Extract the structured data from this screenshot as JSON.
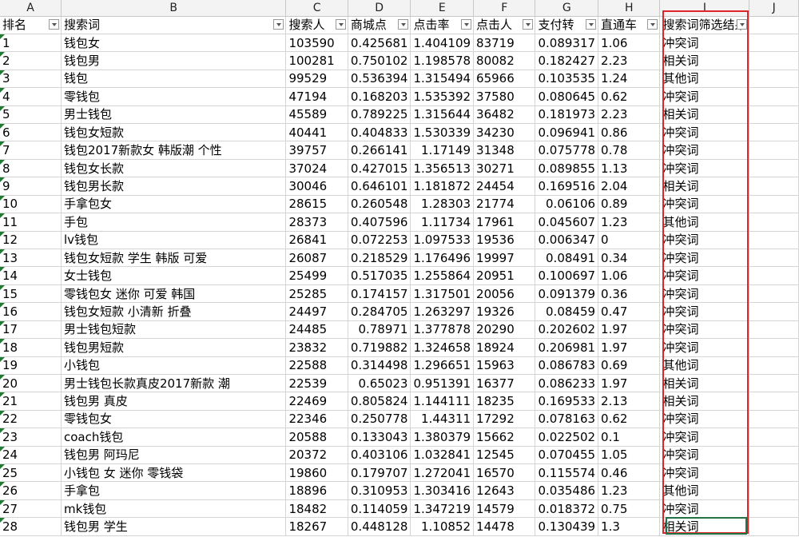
{
  "columns": [
    "A",
    "B",
    "C",
    "D",
    "E",
    "F",
    "G",
    "H",
    "I",
    "J"
  ],
  "headers": [
    "排名",
    "搜索词",
    "搜索人",
    "商城点",
    "点击率",
    "点击人",
    "支付转",
    "直通车",
    "搜索词筛选结果",
    ""
  ],
  "rows": [
    [
      "1",
      "钱包女",
      "103590",
      "0.425681",
      "1.404109",
      "83719",
      "0.089317",
      "1.06",
      "冲突词"
    ],
    [
      "2",
      "钱包男",
      "100281",
      "0.750102",
      "1.198578",
      "80082",
      "0.182427",
      "2.23",
      "相关词"
    ],
    [
      "3",
      "钱包",
      "99529",
      "0.536394",
      "1.315494",
      "65966",
      "0.103535",
      "1.24",
      "其他词"
    ],
    [
      "4",
      "零钱包",
      "47194",
      "0.168203",
      "1.535392",
      "37580",
      "0.080645",
      "0.62",
      "冲突词"
    ],
    [
      "5",
      "男士钱包",
      "45589",
      "0.789225",
      "1.315644",
      "36482",
      "0.181973",
      "2.23",
      "相关词"
    ],
    [
      "6",
      "钱包女短款",
      "40441",
      "0.404833",
      "1.530339",
      "34230",
      "0.096941",
      "0.86",
      "冲突词"
    ],
    [
      "7",
      "钱包2017新款女 韩版潮 个性",
      "39757",
      "0.266141",
      "1.17149",
      "31348",
      "0.075778",
      "0.78",
      "冲突词"
    ],
    [
      "8",
      "钱包女长款",
      "37024",
      "0.427015",
      "1.356513",
      "30271",
      "0.089855",
      "1.13",
      "冲突词"
    ],
    [
      "9",
      "钱包男长款",
      "30046",
      "0.646101",
      "1.181872",
      "24454",
      "0.169516",
      "2.04",
      "相关词"
    ],
    [
      "10",
      "手拿包女",
      "28615",
      "0.260548",
      "1.28303",
      "21774",
      "0.06106",
      "0.89",
      "冲突词"
    ],
    [
      "11",
      "手包",
      "28373",
      "0.407596",
      "1.11734",
      "17961",
      "0.045607",
      "1.23",
      "其他词"
    ],
    [
      "12",
      "lv钱包",
      "26841",
      "0.072253",
      "1.097533",
      "19536",
      "0.006347",
      "0",
      "冲突词"
    ],
    [
      "13",
      "钱包女短款 学生 韩版 可爱",
      "26087",
      "0.218529",
      "1.176496",
      "19997",
      "0.08491",
      "0.34",
      "冲突词"
    ],
    [
      "14",
      "女士钱包",
      "25499",
      "0.517035",
      "1.255864",
      "20951",
      "0.100697",
      "1.06",
      "冲突词"
    ],
    [
      "15",
      "零钱包女 迷你 可爱 韩国",
      "25285",
      "0.174157",
      "1.317501",
      "20056",
      "0.091379",
      "0.36",
      "冲突词"
    ],
    [
      "16",
      "钱包女短款 小清新 折叠",
      "24497",
      "0.284705",
      "1.263297",
      "19326",
      "0.08459",
      "0.47",
      "冲突词"
    ],
    [
      "17",
      "男士钱包短款",
      "24485",
      "0.78971",
      "1.377878",
      "20290",
      "0.202602",
      "1.97",
      "冲突词"
    ],
    [
      "18",
      "钱包男短款",
      "23832",
      "0.719882",
      "1.324658",
      "18924",
      "0.206981",
      "1.97",
      "冲突词"
    ],
    [
      "19",
      "小钱包",
      "22588",
      "0.314498",
      "1.296651",
      "15963",
      "0.086783",
      "0.69",
      "其他词"
    ],
    [
      "20",
      "男士钱包长款真皮2017新款 潮",
      "22539",
      "0.65023",
      "0.951391",
      "16377",
      "0.086233",
      "1.97",
      "相关词"
    ],
    [
      "21",
      "钱包男 真皮",
      "22469",
      "0.805824",
      "1.144111",
      "18235",
      "0.169533",
      "2.13",
      "相关词"
    ],
    [
      "22",
      "零钱包女",
      "22346",
      "0.250778",
      "1.44311",
      "17292",
      "0.078163",
      "0.62",
      "冲突词"
    ],
    [
      "23",
      "coach钱包",
      "20588",
      "0.133043",
      "1.380379",
      "15662",
      "0.022502",
      "0.1",
      "冲突词"
    ],
    [
      "24",
      "钱包男 阿玛尼",
      "20372",
      "0.403106",
      "1.032841",
      "12545",
      "0.070455",
      "1.05",
      "冲突词"
    ],
    [
      "25",
      "小钱包 女 迷你 零钱袋",
      "19860",
      "0.179707",
      "1.272041",
      "16570",
      "0.115574",
      "0.46",
      "冲突词"
    ],
    [
      "26",
      "手拿包",
      "18896",
      "0.310953",
      "1.303416",
      "12643",
      "0.035486",
      "1.23",
      "其他词"
    ],
    [
      "27",
      "mk钱包",
      "18482",
      "0.114059",
      "1.347219",
      "14579",
      "0.018372",
      "0.75",
      "冲突词"
    ],
    [
      "28",
      "钱包男 学生",
      "18267",
      "0.448128",
      "1.10852",
      "14478",
      "0.130439",
      "1.3",
      "相关词"
    ]
  ],
  "colors": {
    "highlight_border": "#e0242b",
    "active_cell": "#217346",
    "error_flag": "#1e7b30"
  }
}
